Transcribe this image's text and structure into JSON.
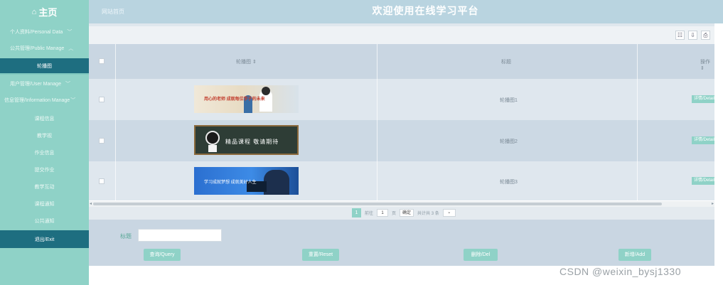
{
  "header": {
    "home_label": "主页",
    "home_icon": "house-icon",
    "site_label": "网站首页",
    "title": "欢迎使用在线学习平台"
  },
  "sidebar": {
    "items": [
      {
        "label": "个人资料/Personal Data",
        "expandable": true
      },
      {
        "label": "公共管理/Public Manage",
        "expandable": true
      },
      {
        "label": "轮播图",
        "active": true
      },
      {
        "label": "用户管理/User Manage",
        "expandable": true
      },
      {
        "label": "信息管理/Information Manage",
        "expandable": true
      },
      {
        "label": "课程信息"
      },
      {
        "label": "教学视"
      },
      {
        "label": "作业信息"
      },
      {
        "label": "提交作业"
      },
      {
        "label": "教学互动"
      },
      {
        "label": "课程通知"
      },
      {
        "label": "公共通知"
      },
      {
        "label": "退出/Exit"
      }
    ]
  },
  "table": {
    "columns": [
      "轮播图",
      "标题",
      "操作"
    ],
    "rows": [
      {
        "title": "轮播图1",
        "action": "详情/Detail",
        "banner_text": "用心的老师 成就每位学子的未来"
      },
      {
        "title": "轮播图2",
        "action": "详情/Detail",
        "banner_text": "精品课程 敬请期待"
      },
      {
        "title": "轮播图3",
        "action": "详情/Detail",
        "banner_text": "学习成就梦想 成就美好人生"
      }
    ]
  },
  "pagination": {
    "current_page": "1",
    "goto_label": "前往",
    "page_input": "1",
    "page_unit": "页",
    "confirm_label": "确定",
    "total_text": "共计共 3 条"
  },
  "search": {
    "field_label": "标题",
    "value": ""
  },
  "actions": {
    "query": "查询/Query",
    "reset": "重置/Reset",
    "delete": "删除/Del",
    "add": "新增/Add"
  },
  "watermark": "CSDN @weixin_bysj1330",
  "colors": {
    "accent": "#8fd2c7",
    "active": "#1e6e80",
    "header": "#b9d4e0",
    "table_header": "#c9d6e2"
  }
}
